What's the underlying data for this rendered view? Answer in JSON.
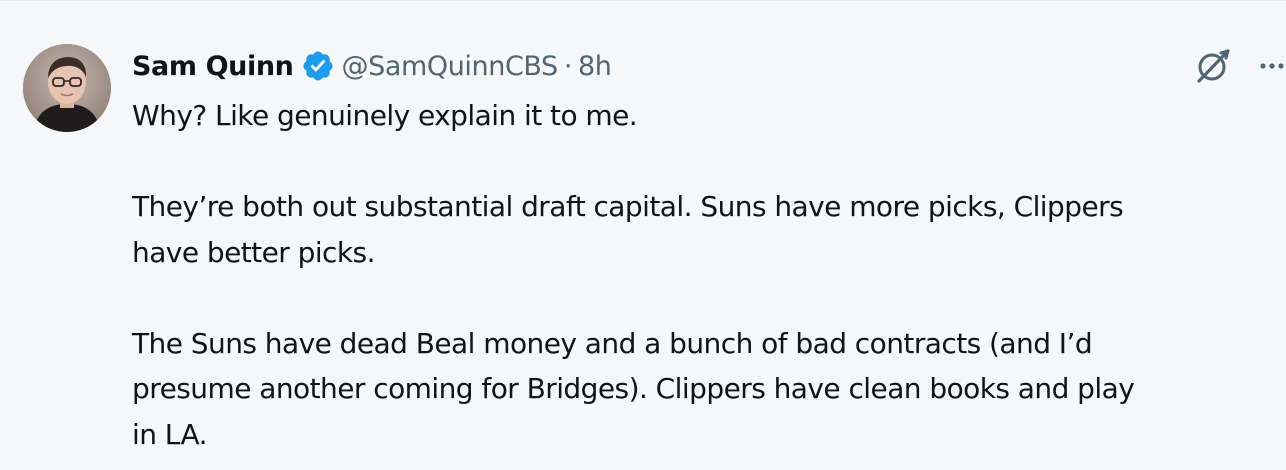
{
  "author": {
    "display_name": "Sam Quinn",
    "handle": "@SamQuinnCBS",
    "separator": "·",
    "time": "8h",
    "verified": true,
    "avatar_icon": "profile-photo"
  },
  "actions": {
    "grok_icon": "grok-icon",
    "more_icon": "more-horizontal-icon"
  },
  "tweet": {
    "p1_line1": "Why? Like genuinely explain it to me.",
    "p2_line1": "They’re both out substantial draft capital. Suns have more picks, Clippers",
    "p2_line2": "have better picks.",
    "p3_line1": "The Suns have dead Beal money and a bunch of bad contracts (and I’d",
    "p3_line2": "presume another coming for Bridges). Clippers have clean books and play",
    "p3_line3": "in LA."
  },
  "colors": {
    "background": "#f5f7f9",
    "text_primary": "#0f1419",
    "text_secondary": "#536471",
    "verified_blue": "#1d9bf0"
  }
}
